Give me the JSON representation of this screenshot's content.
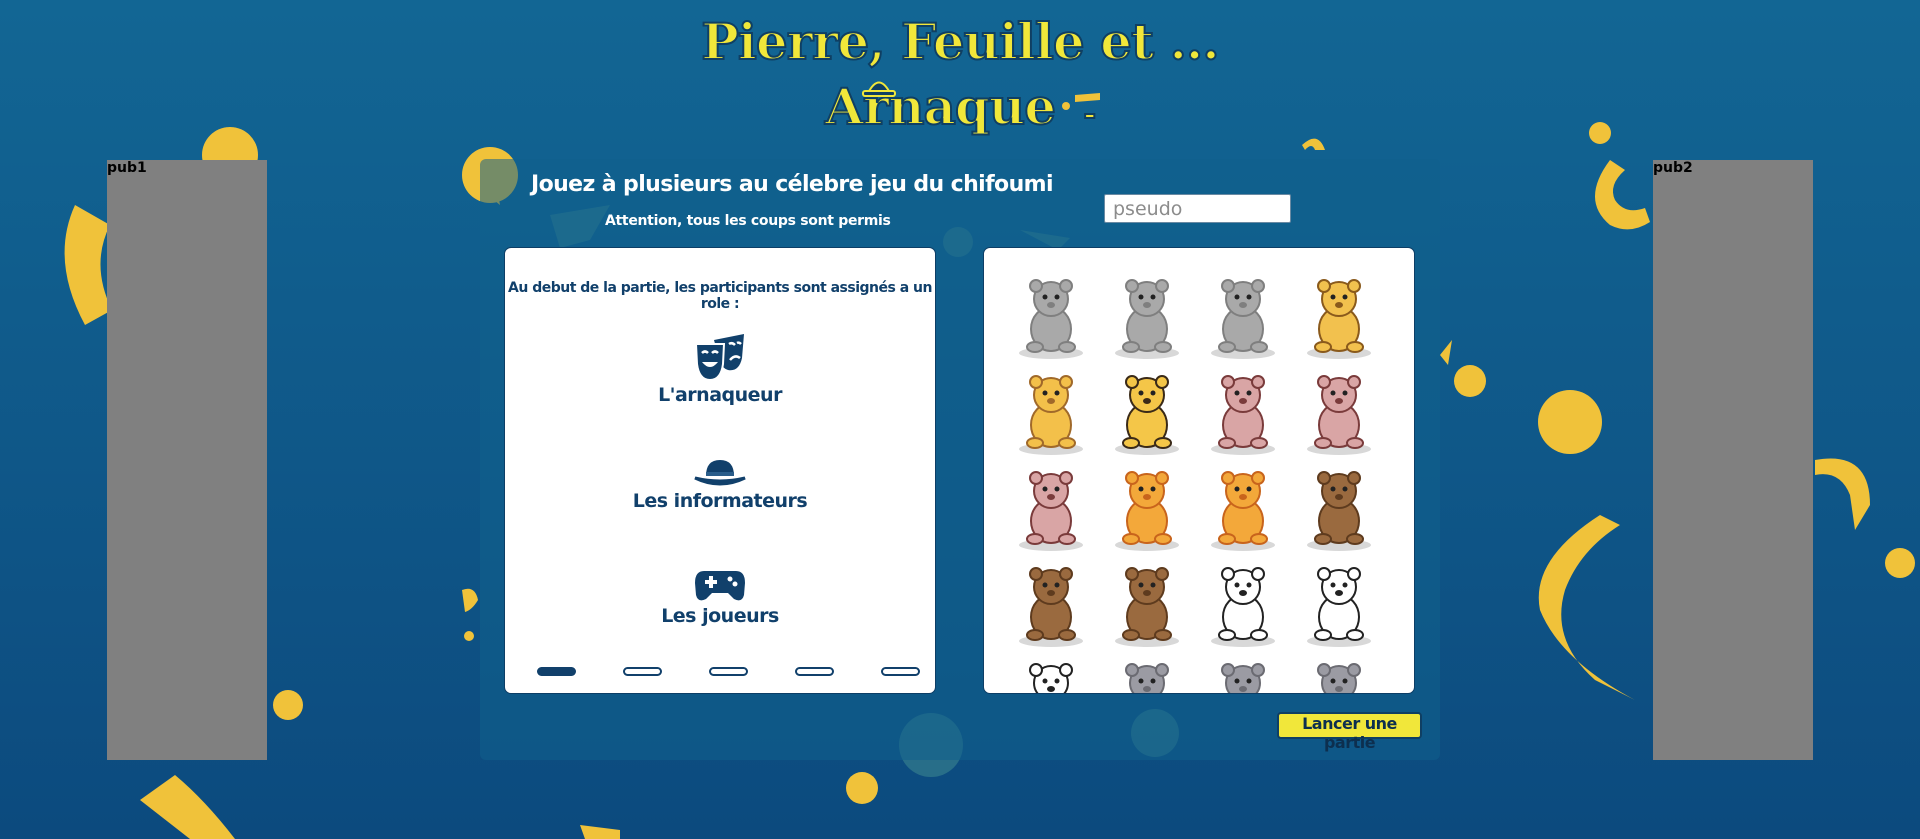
{
  "header": {
    "title_line1": "Pierre, Feuille et ...",
    "title_line2": "Arnaque",
    "title_suffix": "-"
  },
  "ads": {
    "left_label": "pub1",
    "right_label": "pub2"
  },
  "intro": {
    "headline": "Jouez à plusieurs au célebre jeu du chifoumi",
    "subline": "Attention, tous les coups sont permis"
  },
  "pseudo_input": {
    "placeholder": "pseudo",
    "value": ""
  },
  "roles_card": {
    "intro": "Au debut de la partie, les participants sont assignés a un role :",
    "roles": [
      {
        "label": "L'arnaqueur",
        "icon": "theater-masks-icon"
      },
      {
        "label": "Les informateurs",
        "icon": "hat-icon"
      },
      {
        "label": "Les joueurs",
        "icon": "gamepad-icon"
      }
    ],
    "carousel": {
      "slides": 5,
      "active_index": 0
    }
  },
  "avatars": [
    "elephant-dancing",
    "elephant-tusks",
    "elephant-sitting",
    "leopard-yoga",
    "giraffe-sitting",
    "cheetah-sitting",
    "hedgehog-pink",
    "hedgehog-brown",
    "hedgehog-ball",
    "lion-cub-stretch",
    "lion-dancing",
    "bear-brown-standing",
    "bear-waving",
    "bear-cub",
    "panda-sitting",
    "panda-breakdance",
    "panda-peeking",
    "rhino-peeking",
    "rhino-grey",
    "rhino-small"
  ],
  "actions": {
    "launch_label": "Lancer une partie"
  },
  "colors": {
    "accent_yellow": "#f1e73a",
    "navy": "#11406b",
    "background_blue": "#0f5788",
    "ad_grey": "#808080"
  }
}
